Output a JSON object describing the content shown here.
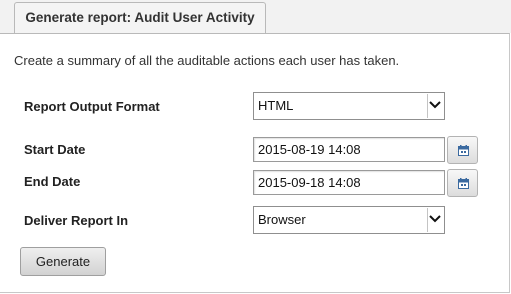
{
  "tab": {
    "title": "Generate report: Audit User Activity"
  },
  "description": "Create a summary of all the auditable actions each user has taken.",
  "form": {
    "output_format": {
      "label": "Report Output Format",
      "value": "HTML"
    },
    "start_date": {
      "label": "Start Date",
      "value": "2015-08-19 14:08"
    },
    "end_date": {
      "label": "End Date",
      "value": "2015-09-18 14:08"
    },
    "deliver_in": {
      "label": "Deliver Report In",
      "value": "Browser"
    }
  },
  "buttons": {
    "generate_label": "Generate"
  },
  "icons": {
    "dropdown": "chevron-down-icon",
    "calendar": "calendar-icon"
  },
  "colors": {
    "calendar_icon": "#3b6aa0",
    "tab_background": "#f4f4f4",
    "button_background": "#dedede"
  }
}
